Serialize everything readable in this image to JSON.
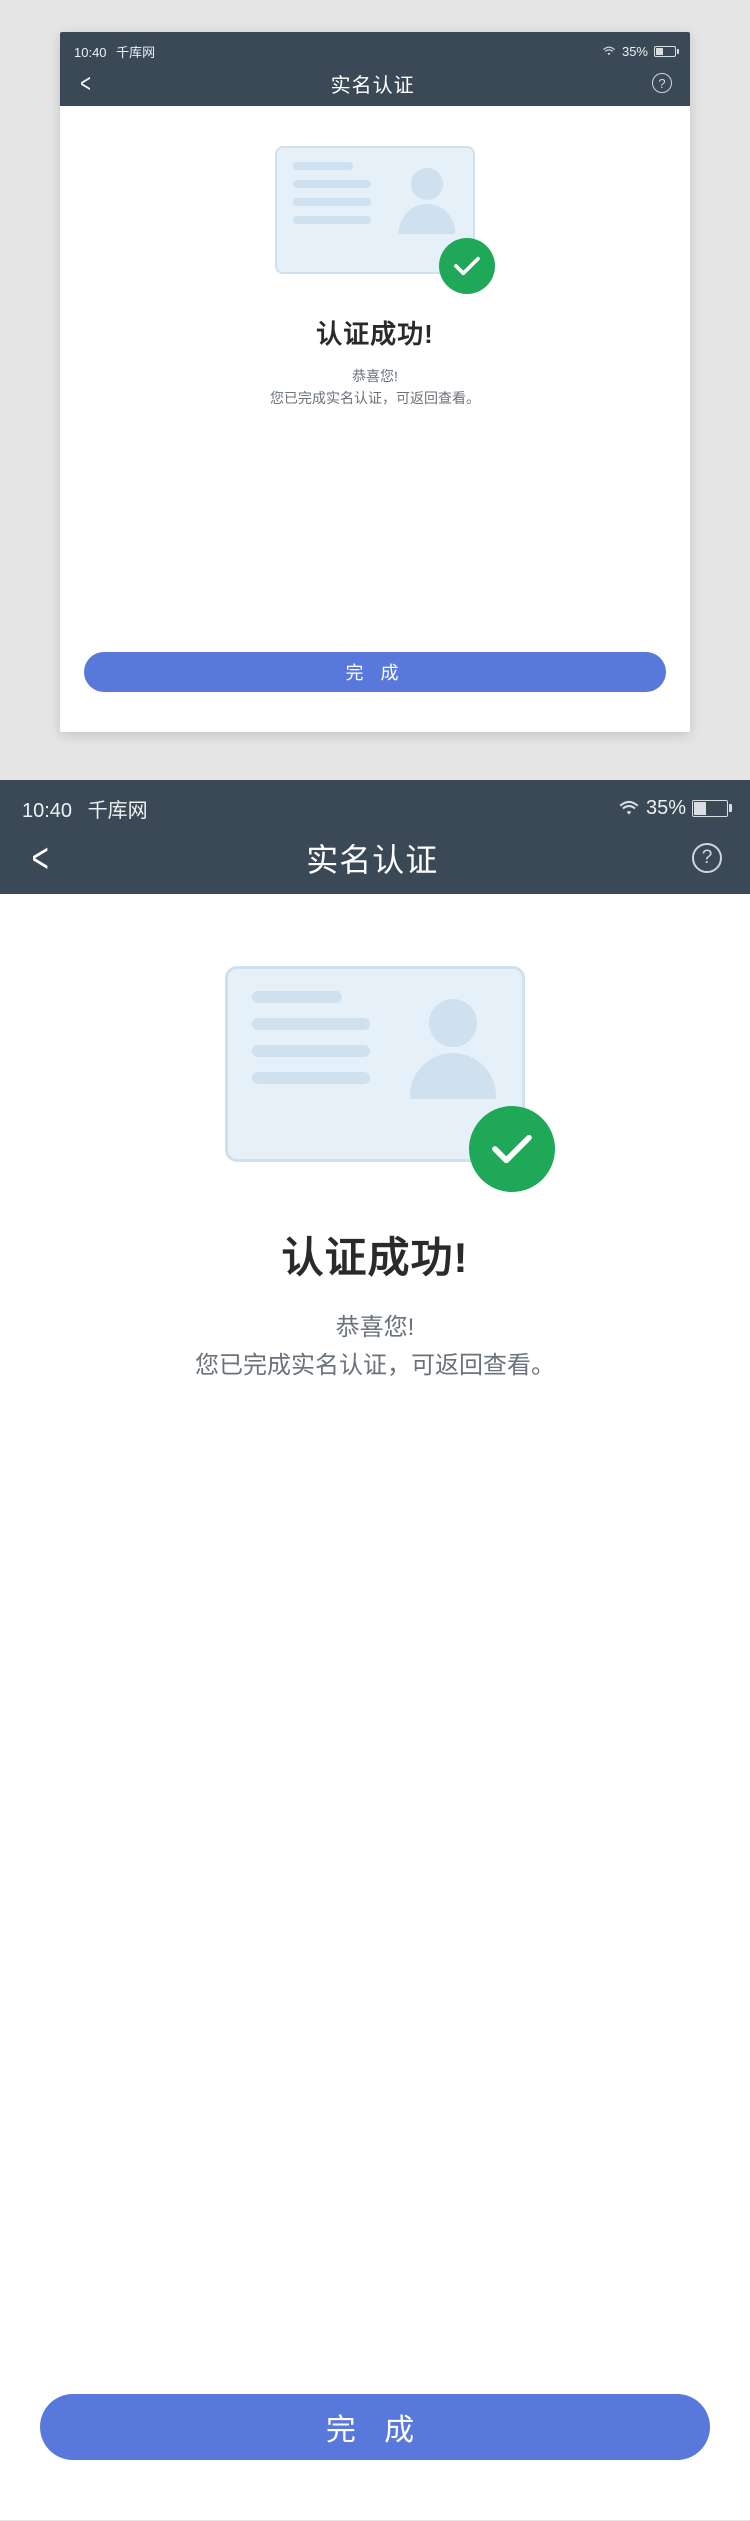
{
  "status": {
    "time": "10:40",
    "carrier": "千库网",
    "battery_percent": "35%"
  },
  "nav": {
    "title": "实名认证",
    "help_label": "?"
  },
  "content": {
    "title": "认证成功!",
    "subtitle_line1": "恭喜您!",
    "subtitle_line2": "您已完成实名认证，可返回查看。"
  },
  "action": {
    "done_label": "完 成"
  },
  "colors": {
    "header_bg": "#3b4956",
    "primary_btn": "#5878dc",
    "success_badge": "#1fa858",
    "card_bg": "#e6f0f8",
    "card_line": "#cfe0ee"
  }
}
